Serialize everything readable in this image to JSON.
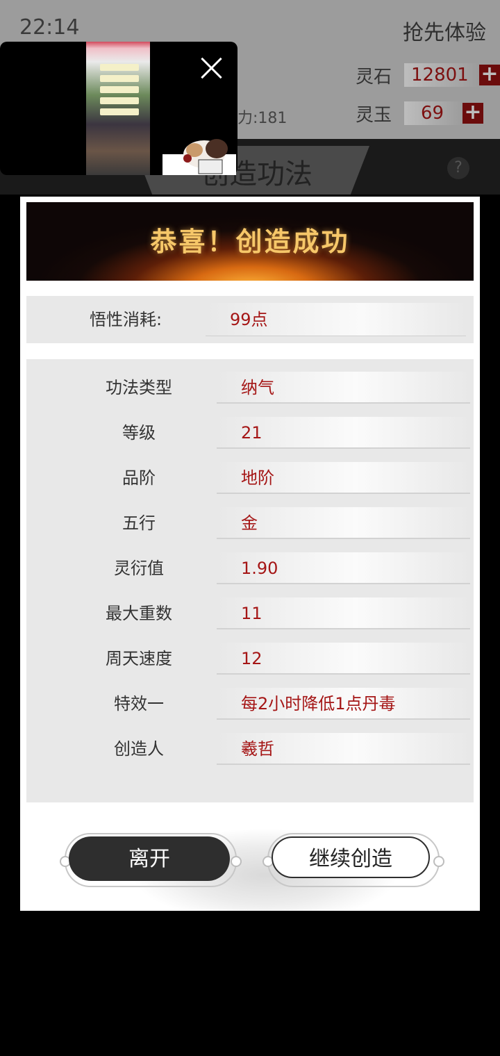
{
  "status_bar": {
    "time": "22:14"
  },
  "header": {
    "first_experience": "抢先体验"
  },
  "resources": [
    {
      "label": "灵石",
      "value": "12801"
    },
    {
      "label": "灵玉",
      "value": "69"
    }
  ],
  "power_text": "力:181",
  "tab_title": "创造功法",
  "dialog": {
    "title": "恭喜！创造成功",
    "cost": {
      "label": "悟性消耗:",
      "value": "99点"
    },
    "stats": [
      {
        "label": "功法类型",
        "value": "纳气"
      },
      {
        "label": "等级",
        "value": "21"
      },
      {
        "label": "品阶",
        "value": "地阶"
      },
      {
        "label": "五行",
        "value": "金"
      },
      {
        "label": "灵衍值",
        "value": "1.90"
      },
      {
        "label": "最大重数",
        "value": "11"
      },
      {
        "label": "周天速度",
        "value": "12"
      },
      {
        "label": "特效一",
        "value": "每2小时降低1点丹毒"
      },
      {
        "label": "创造人",
        "value": "羲哲"
      }
    ],
    "buttons": {
      "leave": "离开",
      "continue": "继续创造"
    }
  },
  "colors": {
    "accent_red": "#a51616",
    "banner_gold": "#f6c769",
    "dark_button": "#2e2e2e"
  }
}
